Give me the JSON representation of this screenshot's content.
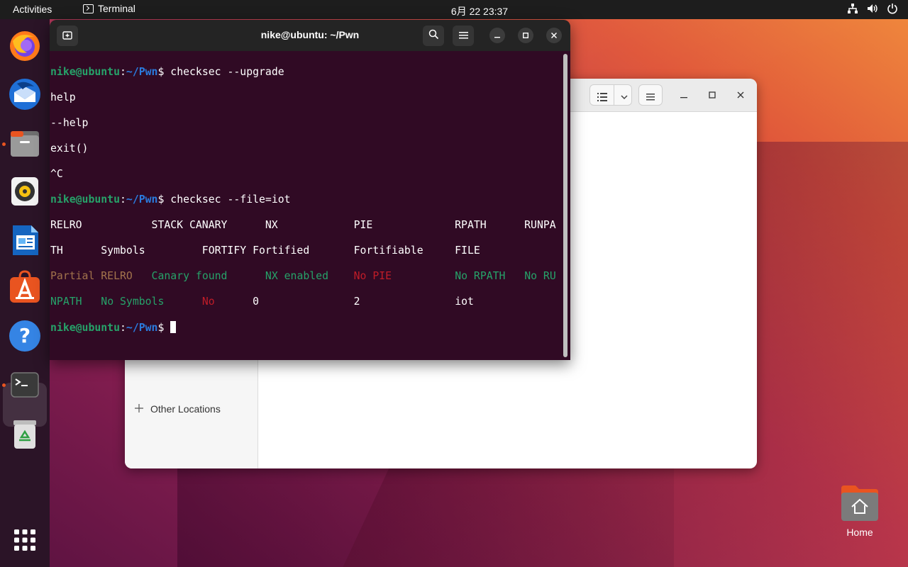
{
  "topbar": {
    "activities": "Activities",
    "app_name": "Terminal",
    "clock": "6月 22  23:37"
  },
  "terminal": {
    "title": "nike@ubuntu: ~/Pwn",
    "prompt_user": "nike@ubuntu",
    "prompt_path": "~/Pwn",
    "lines": {
      "l1_cmd": "checksec --upgrade",
      "l2": "help",
      "l3": "--help",
      "l4": "exit()",
      "l5": "^C",
      "l6_cmd": "checksec --file=iot",
      "l7": "RELRO           STACK CANARY      NX            PIE             RPATH      RUNPA",
      "l8": "TH      Symbols         FORTIFY Fortified       Fortifiable     FILE",
      "l9_a": "Partial RELRO",
      "l9_b": "Canary found",
      "l9_c": "NX enabled",
      "l9_d": "No PIE",
      "l9_e": "No RPATH",
      "l9_f": "No RU",
      "l10_a": "NPATH",
      "l10_b": "No Symbols",
      "l10_c": "No",
      "l10_d": "0",
      "l10_e": "2",
      "l10_f": "iot"
    }
  },
  "files": {
    "other_locations": "Other Locations"
  },
  "desktop": {
    "home_label": "Home"
  },
  "colors": {
    "terminal_bg": "#300a24",
    "prompt_green": "#26a269",
    "path_blue": "#2a7bde",
    "red": "#c01c28",
    "accent": "#e95420"
  }
}
